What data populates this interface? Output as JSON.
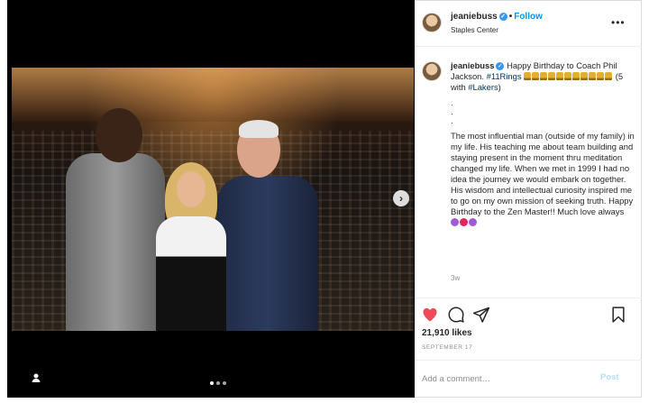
{
  "post": {
    "username": "jeaniebuss",
    "verified_icon": "check-icon",
    "separator": "•",
    "follow_label": "Follow",
    "location": "Staples Center",
    "more_icon": "•••",
    "caption": {
      "line_a": "Happy Birthday to Coach Phil Jackson. ",
      "hashtag_rings": "#11Rings",
      "count_text": "(5 with ",
      "hashtag_lakers": "#Lakers",
      "count_close": ")",
      "dots": [
        ".",
        ".",
        "."
      ],
      "body": "The most influential man (outside of my family) in my life. His teaching me about team building and staying present in the moment thru meditation changed my life. When we met in 1999 I had no idea the journey we would embark on together. His wisdom and intellectual curiosity inspired me to go on my own mission of seeking truth. Happy Birthday to the Zen Master!! Much love always",
      "emoji_colors": [
        "#a05ad6",
        "#e0245e",
        "#a05ad6"
      ],
      "trophy_emoji_count": 11
    },
    "caption_time": "3w",
    "likes_text": "21,910 likes",
    "date_text": "SEPTEMBER 17",
    "comment_placeholder": "Add a comment…",
    "post_label": "Post",
    "next_icon": "›",
    "carousel": {
      "count": 3,
      "active_index": 0
    }
  },
  "colors": {
    "accent": "#0095f6",
    "like_red": "#ed4956",
    "hashtag": "#00376b",
    "muted": "#8e8e8e"
  }
}
